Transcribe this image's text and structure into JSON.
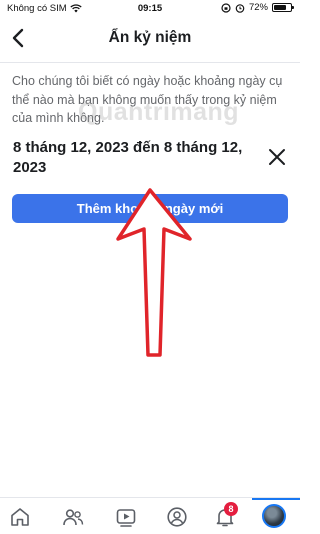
{
  "status_bar": {
    "carrier": "Không có SIM",
    "time": "09:15",
    "battery_text": "72%",
    "battery_level": 0.72,
    "icons": [
      "wifi-icon",
      "orientation-lock-icon",
      "alarm-icon",
      "battery-icon"
    ]
  },
  "header": {
    "title": "Ẩn kỷ niệm",
    "back_icon": "chevron-left-icon"
  },
  "content": {
    "description": "Cho chúng tôi biết có ngày hoặc khoảng ngày cụ thể nào mà bạn không muốn thấy trong kỷ niệm của mình không.",
    "watermark": "Quantrimang",
    "date_range": "8 tháng 12, 2023 đến 8 tháng 12, 2023",
    "remove_icon": "close-icon",
    "add_button_label": "Thêm khoảng ngày mới"
  },
  "annotation": {
    "icon": "red-arrow-up-icon",
    "color": "#e0242a"
  },
  "tab_bar": {
    "tabs": [
      {
        "name": "home-icon"
      },
      {
        "name": "friends-icon"
      },
      {
        "name": "video-icon"
      },
      {
        "name": "marketplace-icon"
      },
      {
        "name": "profile-icon"
      },
      {
        "name": "notifications-icon",
        "badge": "8"
      },
      {
        "name": "avatar",
        "active": true
      }
    ]
  },
  "colors": {
    "primary": "#3b73e9",
    "badge": "#e41e3f",
    "active_tab": "#1877f2",
    "text_secondary": "#65676b"
  }
}
